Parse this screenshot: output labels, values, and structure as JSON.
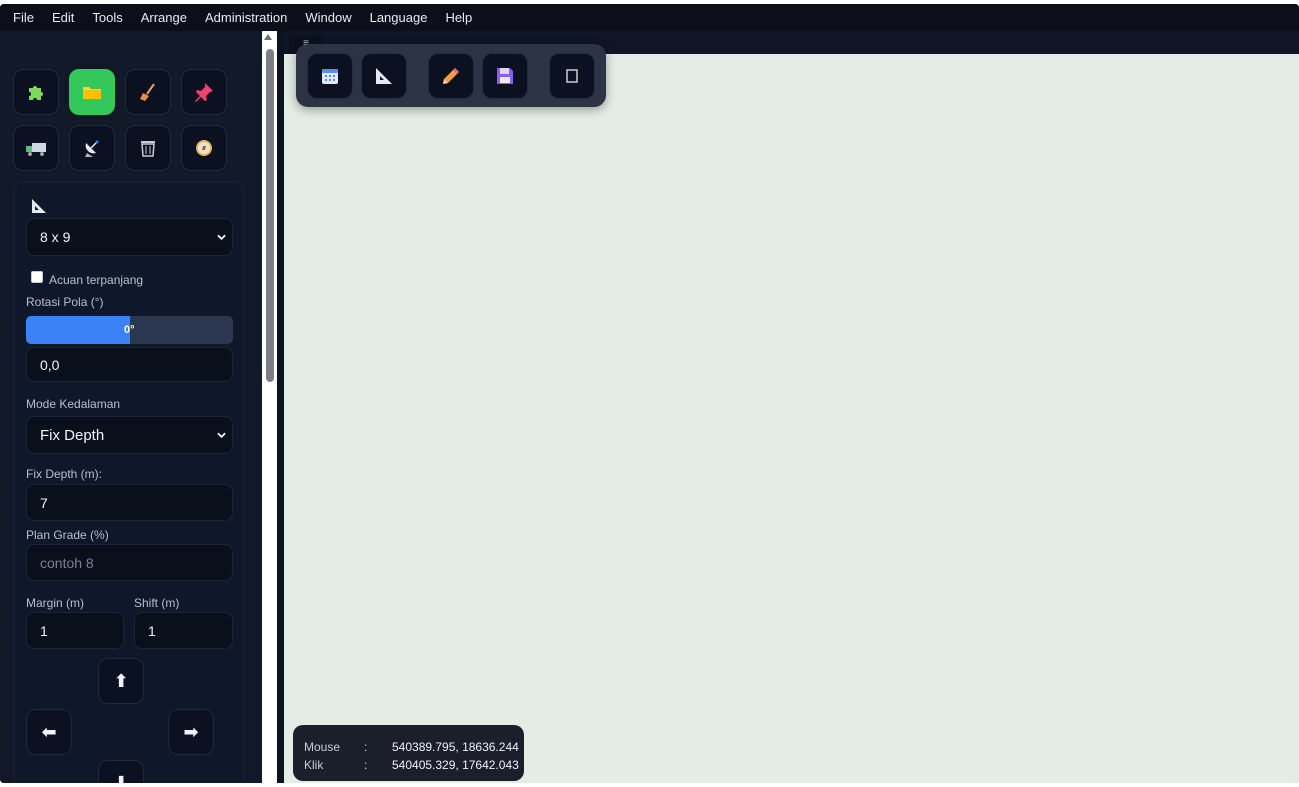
{
  "menubar": {
    "items": [
      "File",
      "Edit",
      "Tools",
      "Arrange",
      "Administration",
      "Window",
      "Language",
      "Help"
    ]
  },
  "sidebar": {
    "tools": [
      {
        "icon": "puzzle-icon",
        "active": false
      },
      {
        "icon": "folder-icon",
        "active": true
      },
      {
        "icon": "broom-icon",
        "active": false
      },
      {
        "icon": "pin-icon",
        "active": false
      },
      {
        "icon": "truck-icon",
        "active": false
      },
      {
        "icon": "satellite-dish-icon",
        "active": false
      },
      {
        "icon": "trash-icon",
        "active": false
      },
      {
        "icon": "compass-icon",
        "active": false
      }
    ],
    "panel": {
      "pattern_icon": "set-square-icon",
      "pattern_select": "8 x 9",
      "longest_reference_label": "Acuan terpanjang",
      "longest_reference_checked": false,
      "rotation_label": "Rotasi Pola (°)",
      "rotation_slider_text": "0°",
      "rotation_slider_fraction": 0.5,
      "rotation_value": "0,0",
      "depth_mode_label": "Mode Kedalaman",
      "depth_mode_select": "Fix Depth",
      "fix_depth_label": "Fix Depth (m):",
      "fix_depth_value": "7",
      "plan_grade_label": "Plan Grade (%)",
      "plan_grade_placeholder": "contoh 8",
      "margin_label": "Margin (m)",
      "margin_value": "1",
      "shift_label": "Shift (m)",
      "shift_value": "1",
      "arrows": {
        "up": "⬆",
        "left": "⬅",
        "right": "➡",
        "down": "⬇"
      }
    }
  },
  "canvas": {
    "tab_icon": "≡",
    "toolbar": [
      "calendar-icon",
      "set-square-icon",
      "pencil-icon",
      "save-icon",
      "square-icon"
    ],
    "coords": {
      "mouse_label": "Mouse",
      "mouse_value": "540389.795, 18636.244",
      "click_label": "Klik",
      "click_value": "540405.329, 17642.043",
      "separator": ":"
    }
  }
}
